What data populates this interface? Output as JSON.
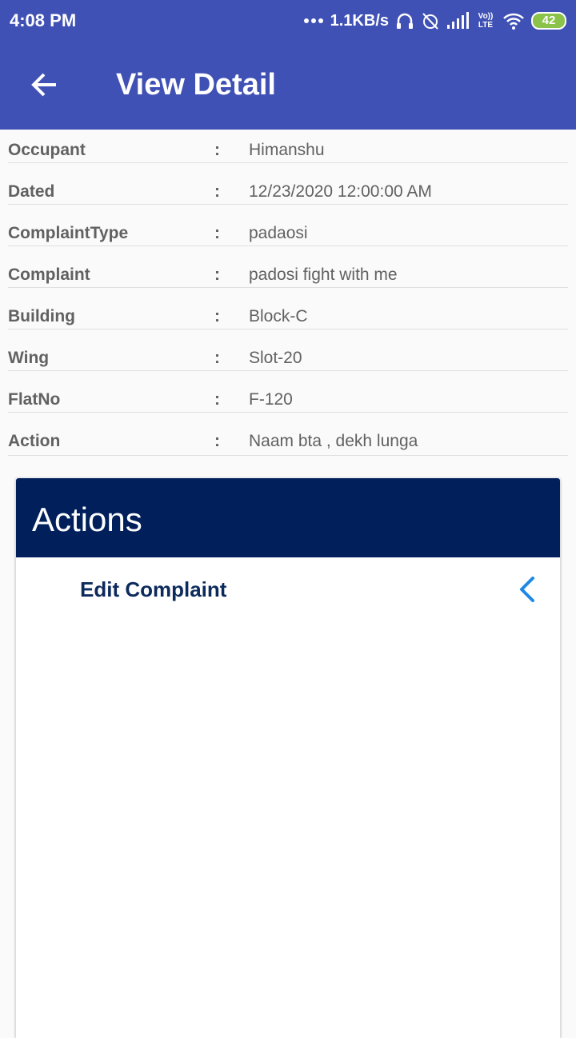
{
  "status_bar": {
    "time": "4:08 PM",
    "net_speed": "1.1KB/s",
    "battery": "42",
    "volte": "Vo)) LTE"
  },
  "app_bar": {
    "title": "View Detail"
  },
  "details": [
    {
      "label": "Occupant",
      "colon": ":",
      "value": "Himanshu"
    },
    {
      "label": "Dated",
      "colon": ":",
      "value": "12/23/2020 12:00:00 AM"
    },
    {
      "label": "ComplaintType",
      "colon": ":",
      "value": "padaosi"
    },
    {
      "label": "Complaint",
      "colon": ":",
      "value": "padosi fight with me"
    },
    {
      "label": "Building",
      "colon": ":",
      "value": "Block-C"
    },
    {
      "label": "Wing",
      "colon": ":",
      "value": "Slot-20"
    },
    {
      "label": "FlatNo",
      "colon": ":",
      "value": "F-120"
    },
    {
      "label": "Action",
      "colon": ":",
      "value": "Naam bta , dekh lunga"
    }
  ],
  "actions_card": {
    "title": "Actions",
    "items": [
      {
        "label": "Edit Complaint",
        "icon": "chevron-left-icon"
      }
    ]
  },
  "colors": {
    "app_bar": "#3f51b5",
    "card_header": "#001f5b",
    "chevron": "#1e88e5",
    "action_label": "#0d2a5c"
  }
}
